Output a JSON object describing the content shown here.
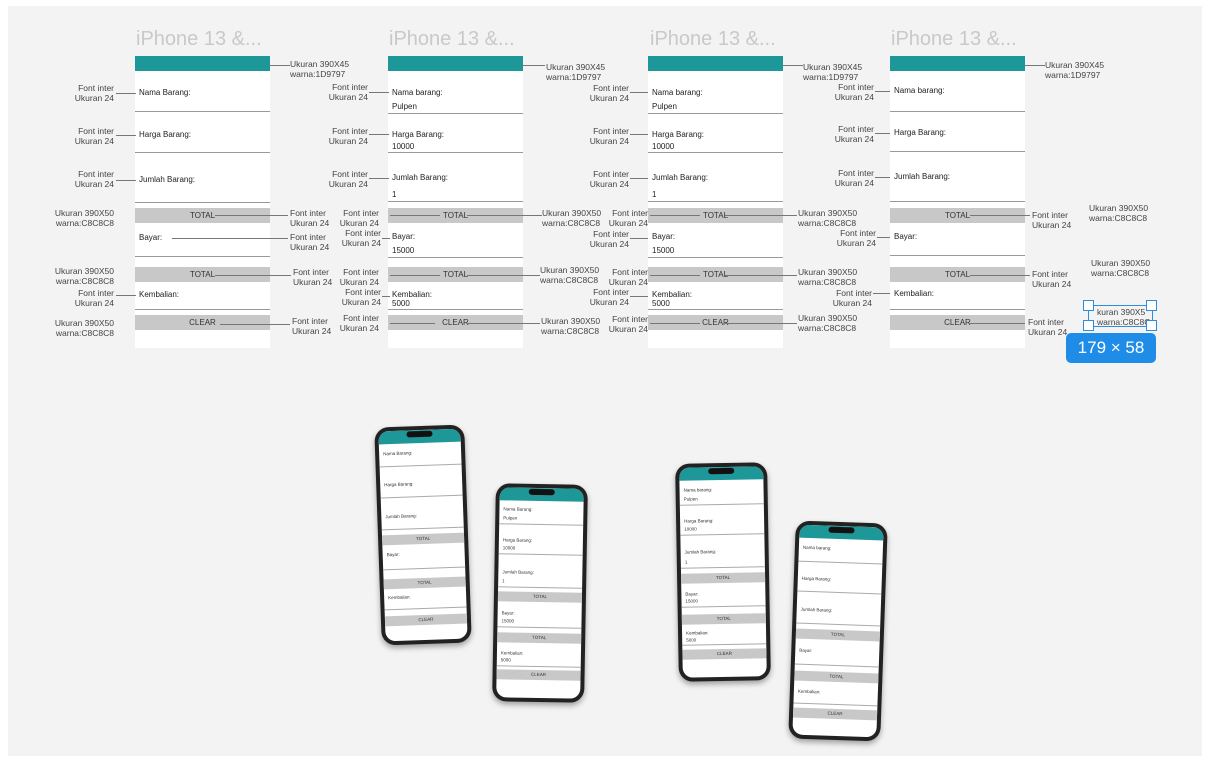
{
  "frames": [
    {
      "title": "iPhone 13 &...",
      "nama": "Nama Barang:",
      "nama_val": "",
      "harga": "Harga Barang:",
      "harga_val": "",
      "jumlah": "Jumlah Barang:",
      "jumlah_val": "",
      "total": "TOTAL",
      "bayar": "Bayar:",
      "bayar_val": "",
      "total2": "TOTAL",
      "kembalian": "Kembalian:",
      "kembalian_val": "",
      "clear": "CLEAR"
    },
    {
      "title": "iPhone 13 &...",
      "nama": "Nama barang:",
      "nama_val": "Pulpen",
      "harga": "Harga Barang:",
      "harga_val": "10000",
      "jumlah": "Jumlah Barang:",
      "jumlah_val": "1",
      "total": "TOTAL",
      "bayar": "Bayar:",
      "bayar_val": "15000",
      "total2": "TOTAL",
      "kembalian": "Kembalian:",
      "kembalian_val": "5000",
      "clear": "CLEAR"
    },
    {
      "title": "iPhone 13 &...",
      "nama": "Nama barang:",
      "nama_val": "Pulpen",
      "harga": "Harga Barang:",
      "harga_val": "10000",
      "jumlah": "Jumlah Barang:",
      "jumlah_val": "1",
      "total": "TOTAL",
      "bayar": "Bayar:",
      "bayar_val": "15000",
      "total2": "TOTAL",
      "kembalian": "Kembalian:",
      "kembalian_val": "5000",
      "clear": "CLEAR"
    },
    {
      "title": "iPhone 13 &...",
      "nama": "Nama barang:",
      "nama_val": "",
      "harga": "Harga Barang:",
      "harga_val": "",
      "jumlah": "Jumlah Barang:",
      "jumlah_val": "",
      "total": "TOTAL",
      "bayar": "Bayar:",
      "bayar_val": "",
      "total2": "TOTAL",
      "kembalian": "Kembalian:",
      "kembalian_val": "",
      "clear": "CLEAR"
    }
  ],
  "annotations": {
    "header_size": "Ukuran 390X45",
    "header_color": "warna:1D9797",
    "font": "Font inter",
    "font_size": "Ukuran 24",
    "btn_size": "Ukuran 390X50",
    "btn_color": "warna:C8C8C8",
    "sel_size_partial": "kuran 390X5",
    "sel_color_partial": "warna:C8C8C"
  },
  "selection": {
    "size_label": "179 × 58"
  },
  "colors": {
    "header": "#1D9797",
    "button": "#C8C8C8",
    "selection": "#2d8ee0"
  },
  "phones": [
    {
      "nama": "Nama Barang:",
      "nama_val": "",
      "harga": "Harga Barang:",
      "harga_val": "",
      "jumlah": "Jumlah Barang:",
      "jumlah_val": "",
      "total": "TOTAL",
      "bayar": "Bayar:",
      "bayar_val": "",
      "total2": "TOTAL",
      "kembalian": "Kembalian:",
      "kembalian_val": "",
      "clear": "CLEAR"
    },
    {
      "nama": "Nama Barang:",
      "nama_val": "Pulpen",
      "harga": "Harga Barang:",
      "harga_val": "10000",
      "jumlah": "Jumlah Barang:",
      "jumlah_val": "1",
      "total": "TOTAL",
      "bayar": "Bayar:",
      "bayar_val": "15000",
      "total2": "TOTAL",
      "kembalian": "Kembalian:",
      "kembalian_val": "5000",
      "clear": "CLEAR"
    },
    {
      "nama": "Nama barang:",
      "nama_val": "Pulpen",
      "harga": "Harga Barang:",
      "harga_val": "10000",
      "jumlah": "Jumlah Barang:",
      "jumlah_val": "1",
      "total": "TOTAL",
      "bayar": "Bayar:",
      "bayar_val": "15000",
      "total2": "TOTAL",
      "kembalian": "Kembalian:",
      "kembalian_val": "5000",
      "clear": "CLEAR"
    },
    {
      "nama": "Nama barang:",
      "nama_val": "",
      "harga": "Harga Barang:",
      "harga_val": "",
      "jumlah": "Jumlah Barang:",
      "jumlah_val": "",
      "total": "TOTAL",
      "bayar": "Bayar:",
      "bayar_val": "",
      "total2": "TOTAL",
      "kembalian": "Kembalian:",
      "kembalian_val": "",
      "clear": "CLEAR"
    }
  ]
}
